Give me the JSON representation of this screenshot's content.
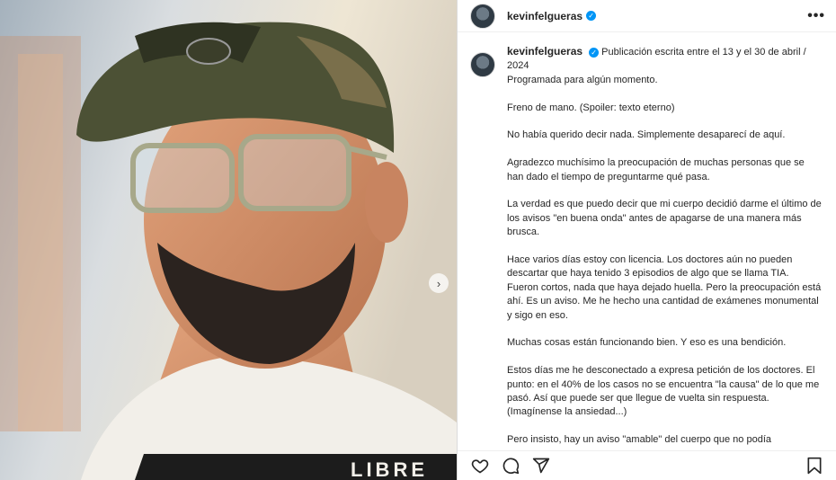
{
  "post": {
    "username": "kevinfelgueras",
    "verified_icon": "verified-badge-icon",
    "more_icon": "more-options-icon",
    "caption_intro": "Publicación escrita entre el 13 y el 30 de abril / 2024",
    "caption_paragraphs": [
      "Programada para algún momento.",
      "Freno de mano. (Spoiler: texto eterno)",
      "No había querido decir nada. Simplemente desaparecí de aquí.",
      "Agradezco muchísimo la preocupación de muchas personas que se han dado el tiempo de preguntarme qué pasa.",
      "La verdad es que puedo decir que mi cuerpo decidió darme el último de los avisos \"en buena onda\" antes de apagarse de una manera más brusca.",
      "Hace varios días estoy con licencia. Los doctores aún no pueden descartar que haya tenido 3 episodios de algo que se llama TIA. Fueron cortos, nada que haya dejado huella. Pero la preocupación está ahí. Es un aviso. Me he hecho una cantidad de exámenes monumental y sigo en eso.",
      "Muchas cosas están funcionando bien. Y eso es una bendición.",
      "Estos días me he desconectado a expresa petición de los doctores. El punto: en el 40% de los casos no se encuentra \"la causa\" de lo que me pasó. Así que puede ser que llegue de vuelta sin respuesta. (Imagínense la ansiedad...)",
      "Pero insisto, hay un aviso \"amable\" del cuerpo que no podía"
    ],
    "shirt_text": "LIBRE",
    "accent_color": "#0095f6"
  },
  "actions": {
    "like_icon": "heart-icon",
    "comment_icon": "comment-icon",
    "share_icon": "share-icon",
    "save_icon": "bookmark-icon"
  }
}
